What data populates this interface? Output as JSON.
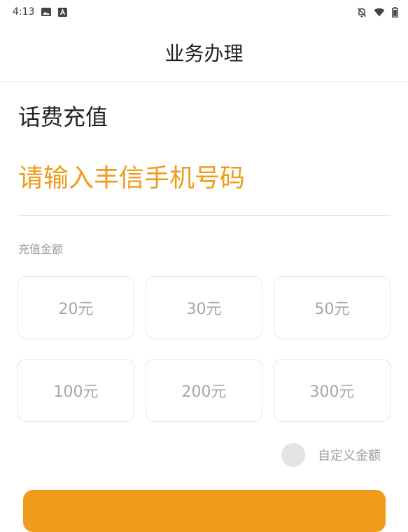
{
  "status_bar": {
    "time": "4:13",
    "left_icons": [
      "image-icon",
      "app-icon"
    ],
    "right_icons": [
      "bell-off-icon",
      "wifi-icon",
      "battery-icon"
    ]
  },
  "header": {
    "title": "业务办理"
  },
  "recharge": {
    "section_title": "话费充值",
    "phone_placeholder": "请输入丰信手机号码",
    "phone_value": "",
    "amount_label": "充值金额",
    "amounts": [
      "20元",
      "30元",
      "50元",
      "100元",
      "200元",
      "300元"
    ],
    "custom_amount_label": "自定义金额"
  },
  "colors": {
    "accent": "#f09b1b",
    "muted_text": "#a6a6a6",
    "border": "#e6e6e6"
  }
}
